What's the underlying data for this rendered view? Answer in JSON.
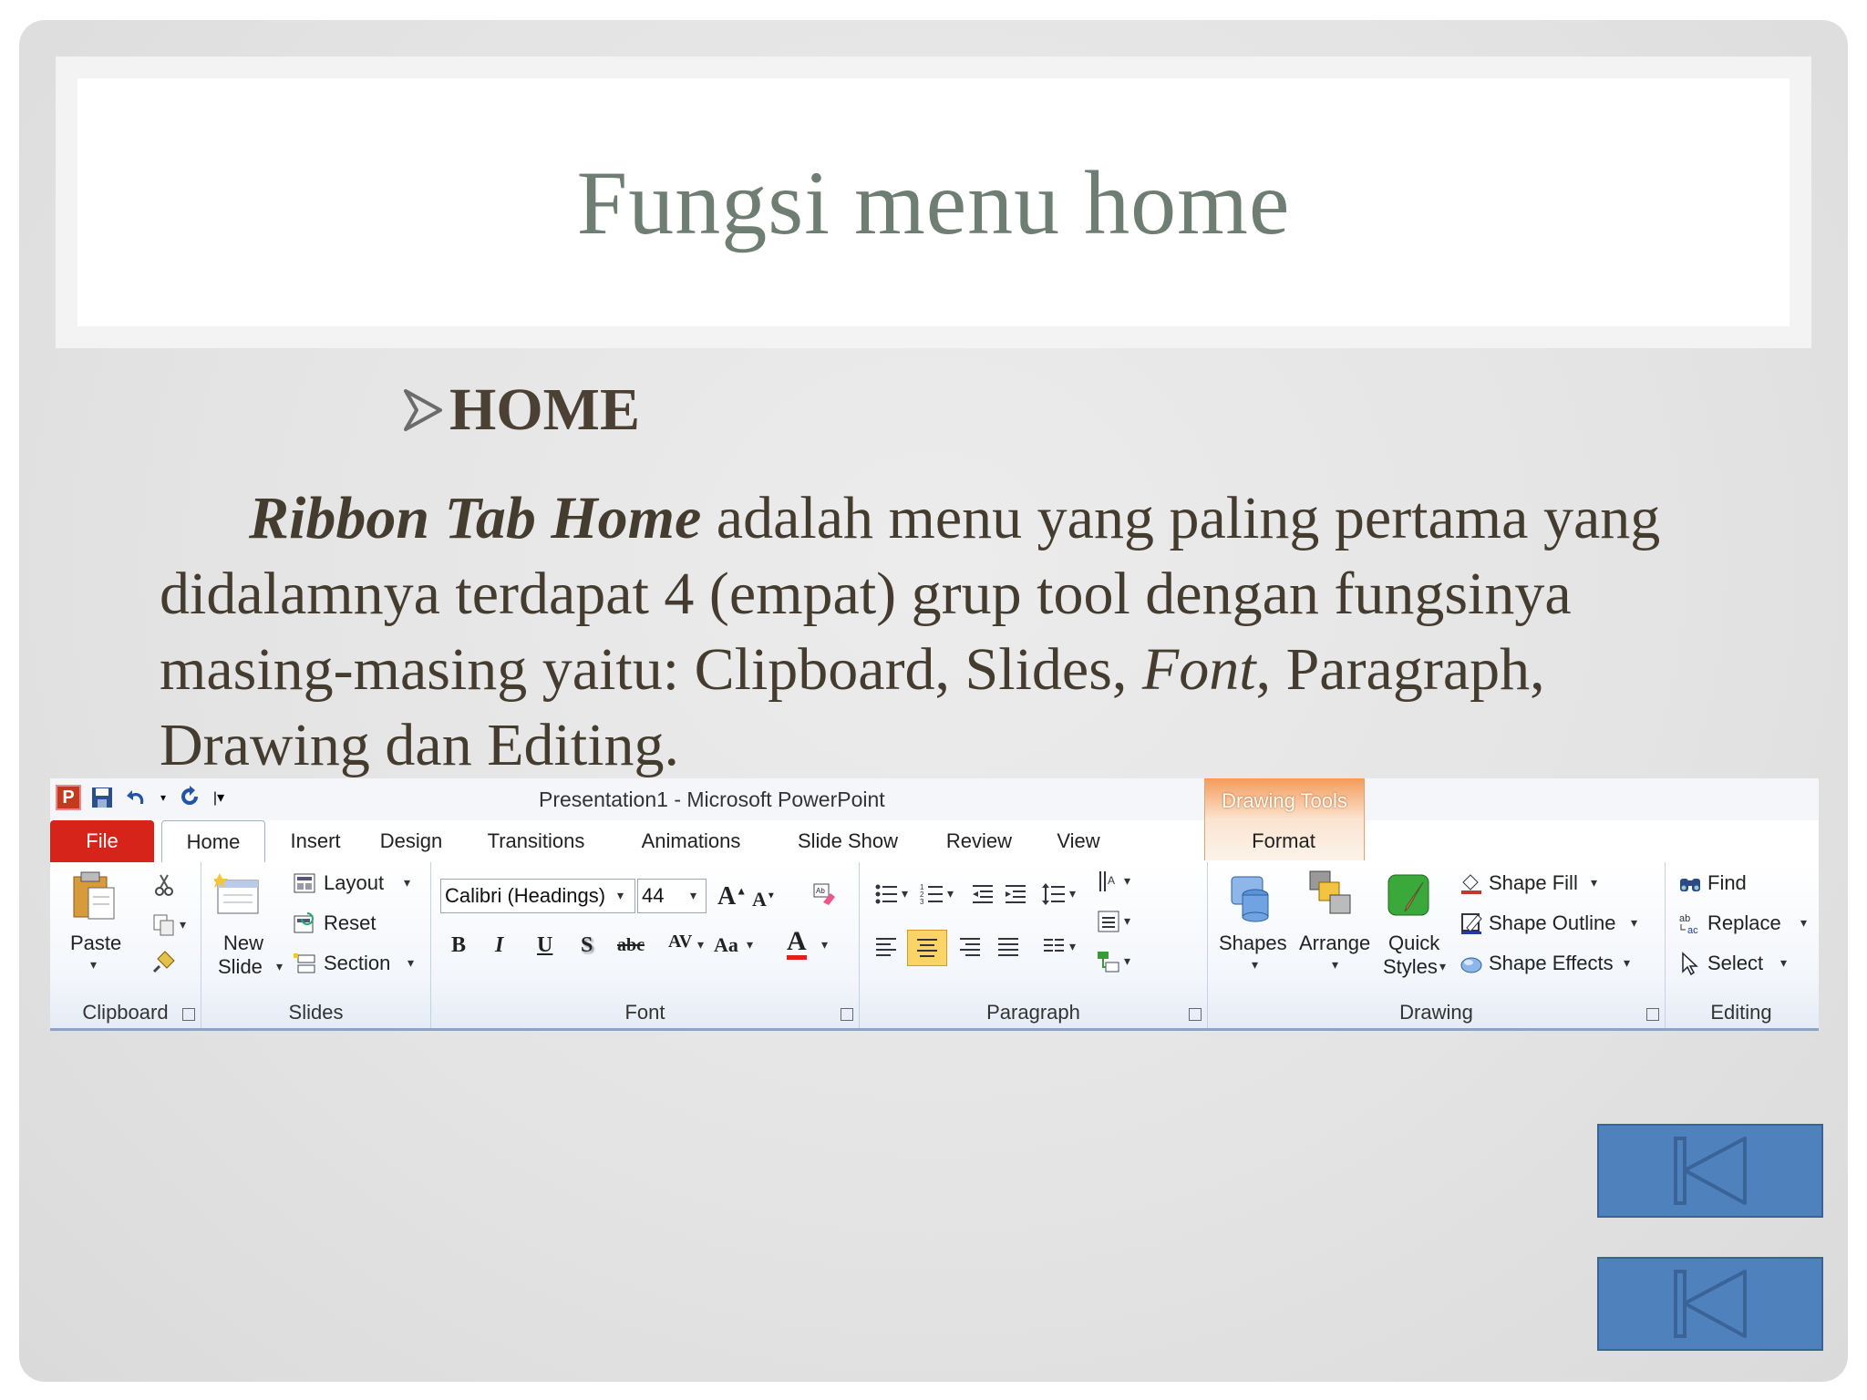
{
  "slide": {
    "title": "Fungsi menu home",
    "heading": "HOME",
    "body_lead_italic": "Ribbon Tab Home",
    "body_part1": " adalah menu yang paling pertama yang didalamnya terdapat 4 (empat) grup tool dengan fungsinya masing-masing yaitu: Clipboard, Slides, ",
    "body_font_italic": "Font",
    "body_part2": ", Paragraph, Drawing dan Editing."
  },
  "ribbon": {
    "window_title": "Presentation1  -  Microsoft PowerPoint",
    "context_tab": "Drawing Tools",
    "app_icon": "P",
    "tabs": [
      "File",
      "Home",
      "Insert",
      "Design",
      "Transitions",
      "Animations",
      "Slide Show",
      "Review",
      "View",
      "Format"
    ],
    "clipboard": {
      "paste": "Paste",
      "label": "Clipboard"
    },
    "slides": {
      "new_slide_1": "New",
      "new_slide_2": "Slide",
      "layout": "Layout",
      "reset": "Reset",
      "section": "Section",
      "label": "Slides"
    },
    "font": {
      "font_name": "Calibri (Headings)",
      "font_size": "44",
      "bold": "B",
      "italic": "I",
      "underline": "U",
      "shadow": "S",
      "strike": "abc",
      "spacing": "AV",
      "case": "Aa",
      "color": "A",
      "label": "Font"
    },
    "paragraph": {
      "label": "Paragraph"
    },
    "drawing": {
      "shapes": "Shapes",
      "arrange": "Arrange",
      "quick_1": "Quick",
      "quick_2": "Styles",
      "shape_fill": "Shape Fill",
      "shape_outline": "Shape Outline",
      "shape_effects": "Shape Effects",
      "label": "Drawing"
    },
    "editing": {
      "find": "Find",
      "replace": "Replace",
      "select": "Select",
      "label": "Editing"
    }
  },
  "colors": {
    "title": "#6e7e72",
    "body": "#453c30",
    "nav_button": "#4f81bd",
    "file_tab": "#d7241b"
  },
  "icons": [
    "save-icon",
    "undo-icon",
    "redo-icon",
    "paste-icon",
    "cut-icon",
    "copy-icon",
    "format-painter-icon",
    "new-slide-icon",
    "bullets-icon",
    "numbering-icon",
    "align-center-icon",
    "shapes-icon",
    "arrange-icon",
    "quick-styles-icon",
    "find-icon",
    "replace-icon",
    "select-icon",
    "first-slide-icon"
  ]
}
